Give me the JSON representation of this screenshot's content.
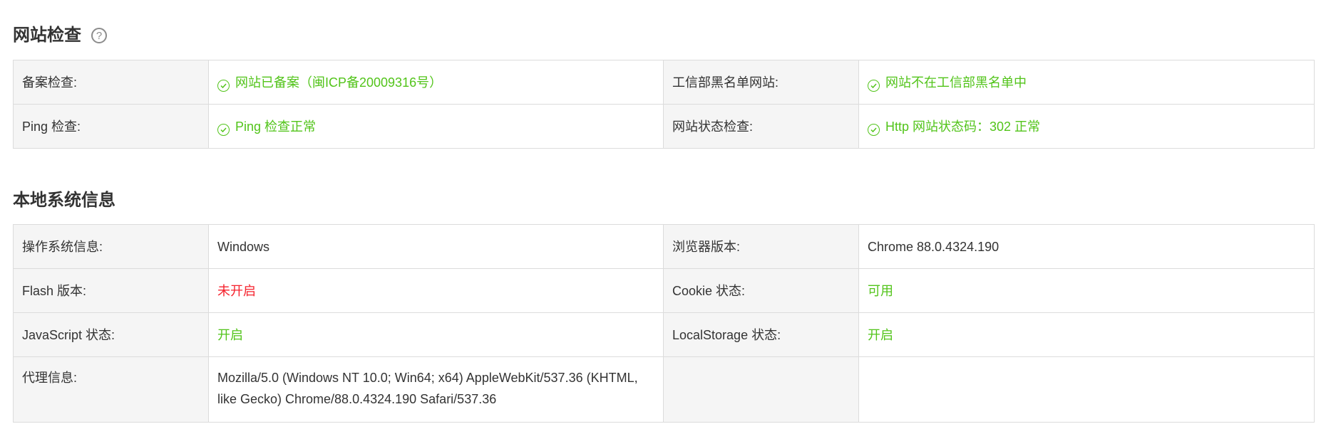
{
  "sections": {
    "website_check": {
      "title": "网站检查",
      "help_icon": "question-circle-icon",
      "rows": [
        {
          "label1": "备案检查:",
          "value1": "网站已备案（闽ICP备20009316号）",
          "label2": "工信部黑名单网站:",
          "value2": "网站不在工信部黑名单中"
        },
        {
          "label1": "Ping 检查:",
          "value1": "Ping 检查正常",
          "label2": "网站状态检查:",
          "value2": "Http 网站状态码：302 正常"
        }
      ]
    },
    "local_system": {
      "title": "本地系统信息",
      "rows": [
        {
          "label1": "操作系统信息:",
          "value1": "Windows",
          "label2": "浏览器版本:",
          "value2": "Chrome 88.0.4324.190"
        },
        {
          "label1": "Flash 版本:",
          "value1": "未开启",
          "label2": "Cookie 状态:",
          "value2": "可用"
        },
        {
          "label1": "JavaScript 状态:",
          "value1": "开启",
          "label2": "LocalStorage 状态:",
          "value2": "开启"
        },
        {
          "label1": "代理信息:",
          "value1_line1": "Mozilla/5.0 (Windows NT 10.0; Win64; x64) AppleWebKit/537.36 (KHTML,",
          "value1_line2": "like Gecko) Chrome/88.0.4324.190 Safari/537.36",
          "label2": "",
          "value2": ""
        }
      ]
    }
  },
  "colors": {
    "ok": "#52c41a",
    "bad": "#f5222d",
    "label_bg": "#f5f5f5",
    "border": "#dcdcdc"
  }
}
